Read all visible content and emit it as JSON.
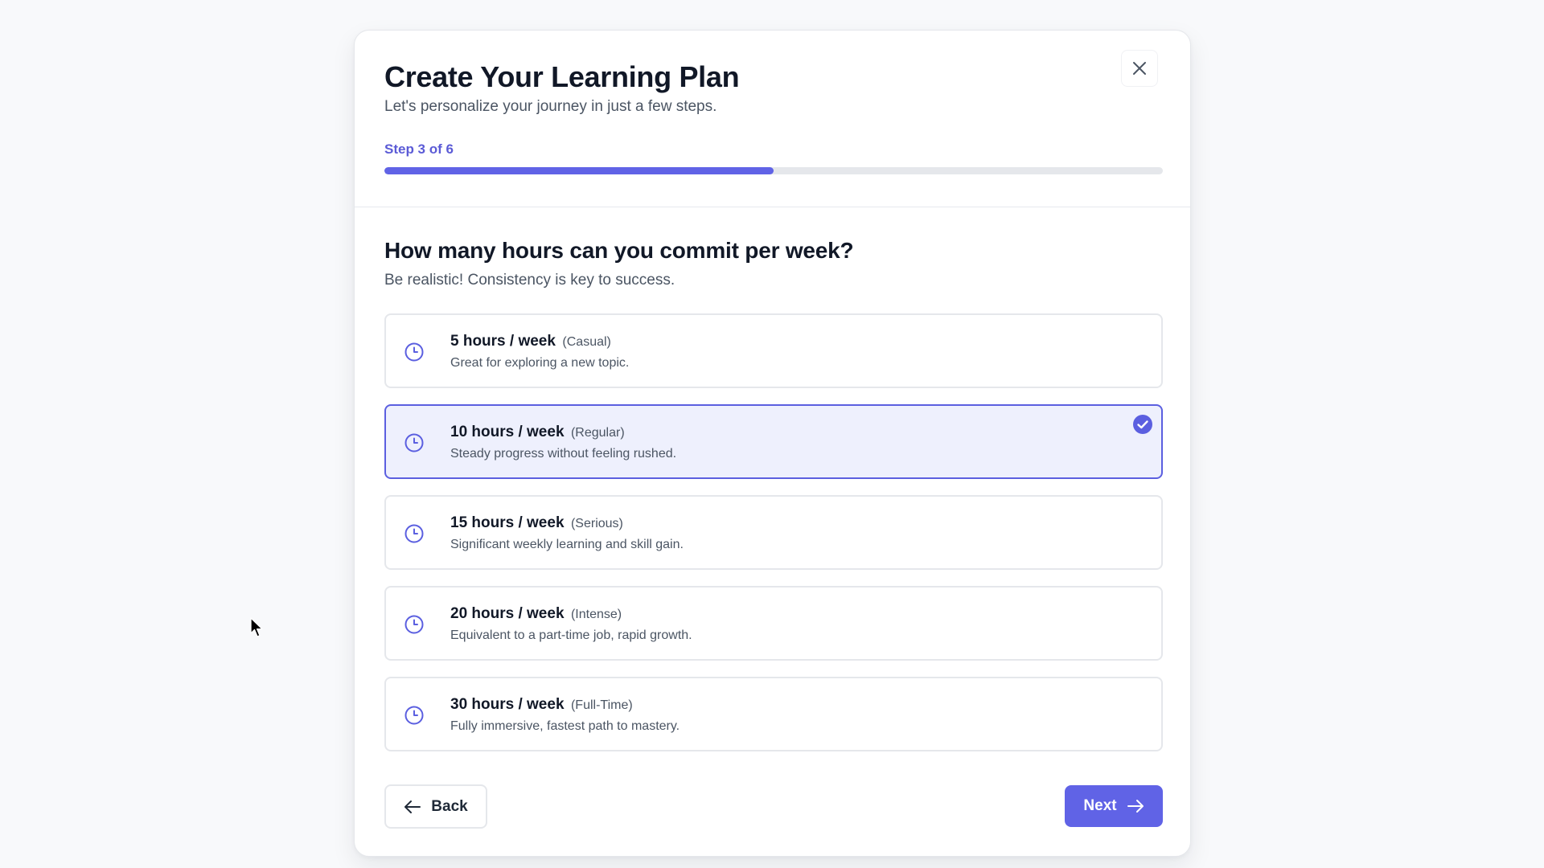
{
  "modal": {
    "title": "Create Your Learning Plan",
    "subtitle": "Let's personalize your journey in just a few steps.",
    "step_label": "Step 3 of 6",
    "progress_fraction": 0.5
  },
  "question": {
    "title": "How many hours can you commit per week?",
    "hint": "Be realistic! Consistency is key to success."
  },
  "options": [
    {
      "title": "5 hours / week",
      "tag": "(Casual)",
      "desc": "Great for exploring a new topic.",
      "selected": false
    },
    {
      "title": "10 hours / week",
      "tag": "(Regular)",
      "desc": "Steady progress without feeling rushed.",
      "selected": true
    },
    {
      "title": "15 hours / week",
      "tag": "(Serious)",
      "desc": "Significant weekly learning and skill gain.",
      "selected": false
    },
    {
      "title": "20 hours / week",
      "tag": "(Intense)",
      "desc": "Equivalent to a part-time job, rapid growth.",
      "selected": false
    },
    {
      "title": "30 hours / week",
      "tag": "(Full-Time)",
      "desc": "Fully immersive, fastest path to mastery.",
      "selected": false
    }
  ],
  "footer": {
    "back_label": "Back",
    "next_label": "Next"
  },
  "colors": {
    "accent": "#6063e6",
    "selected_bg": "#eef0fd",
    "border": "#e5e7eb"
  },
  "icons": {
    "close": "close-icon",
    "option": "clock-icon",
    "check": "check-circle-icon",
    "back": "arrow-left-icon",
    "next": "arrow-right-icon"
  }
}
